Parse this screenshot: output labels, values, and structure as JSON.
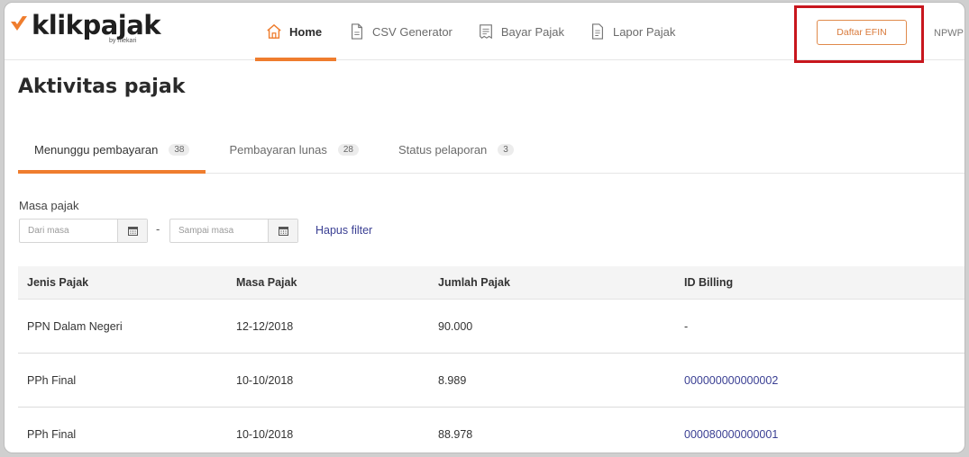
{
  "brand": {
    "name": "klikpajak",
    "sub": "by mekari",
    "accent": "#ef7d2e"
  },
  "nav": [
    {
      "label": "Home",
      "icon": "home-icon",
      "active": true
    },
    {
      "label": "CSV Generator",
      "icon": "csv-file-icon",
      "active": false
    },
    {
      "label": "Bayar Pajak",
      "icon": "receipt-icon",
      "active": false
    },
    {
      "label": "Lapor Pajak",
      "icon": "report-file-icon",
      "active": false
    }
  ],
  "header": {
    "efin_button": "Daftar EFIN",
    "npwp_label": "NPWP:"
  },
  "page_title": "Aktivitas pajak",
  "tabs": [
    {
      "label": "Menunggu pembayaran",
      "count": "38",
      "active": true
    },
    {
      "label": "Pembayaran lunas",
      "count": "28",
      "active": false
    },
    {
      "label": "Status pelaporan",
      "count": "3",
      "active": false
    }
  ],
  "filter": {
    "label": "Masa pajak",
    "from_placeholder": "Dari masa",
    "to_placeholder": "Sampai masa",
    "separator": "-",
    "clear": "Hapus filter"
  },
  "table": {
    "headers": [
      "Jenis Pajak",
      "Masa Pajak",
      "Jumlah Pajak",
      "ID Billing"
    ],
    "rows": [
      {
        "jenis": "PPN Dalam Negeri",
        "masa": "12-12/2018",
        "jumlah": "90.000",
        "billing": "-"
      },
      {
        "jenis": "PPh Final",
        "masa": "10-10/2018",
        "jumlah": "8.989",
        "billing": "000000000000002"
      },
      {
        "jenis": "PPh Final",
        "masa": "10-10/2018",
        "jumlah": "88.978",
        "billing": "000080000000001"
      }
    ]
  },
  "colors": {
    "highlight": "#c8161d",
    "link": "#3a3f93"
  }
}
